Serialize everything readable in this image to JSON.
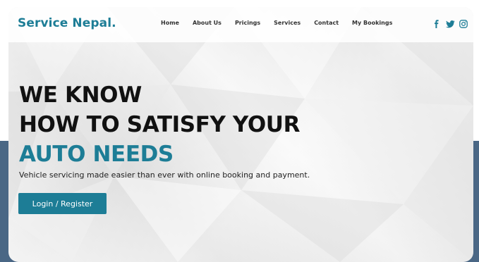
{
  "brand": {
    "name": "Service Nepal."
  },
  "nav": {
    "items": [
      {
        "label": "Home"
      },
      {
        "label": "About Us"
      },
      {
        "label": "Pricings"
      },
      {
        "label": "Services"
      },
      {
        "label": "Contact"
      },
      {
        "label": "My Bookings"
      }
    ]
  },
  "socials": {
    "icons": [
      "facebook-icon",
      "twitter-icon",
      "instagram-icon"
    ]
  },
  "hero": {
    "line1": "WE KNOW",
    "line2": "HOW TO SATISFY YOUR",
    "line3": "AUTO NEEDS",
    "subtitle": "Vehicle servicing made easier than ever with online booking and payment."
  },
  "cta": {
    "label": "Login / Register"
  },
  "colors": {
    "accent": "#1d7d96",
    "backdrop": "#4a6785",
    "text": "#111111"
  }
}
